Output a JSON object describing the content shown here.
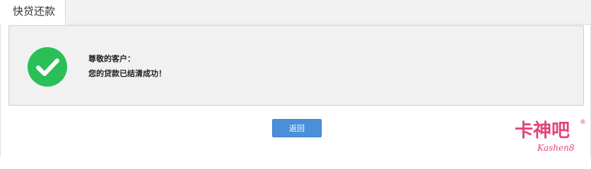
{
  "header": {
    "title": "快贷还款"
  },
  "message": {
    "greeting": "尊敬的客户：",
    "body": "您的贷款已结清成功！"
  },
  "actions": {
    "back_label": "返回"
  },
  "watermark": {
    "text": "卡神吧",
    "sub": "Kashen8",
    "registered": "®"
  },
  "colors": {
    "success": "#2bbf57",
    "button": "#4a90d9",
    "watermark": "#e0457b"
  },
  "icons": {
    "status": "check-circle-icon"
  }
}
